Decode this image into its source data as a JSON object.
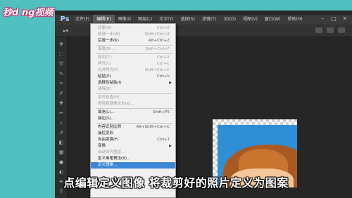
{
  "watermark": {
    "logo_text": "秒d ng视频"
  },
  "app": {
    "logo": "Ps"
  },
  "menubar": {
    "items": [
      {
        "label": "文件(F)"
      },
      {
        "label": "编辑(E)",
        "active": true
      },
      {
        "label": "图像(I)"
      },
      {
        "label": "图层(L)"
      },
      {
        "label": "文字(Y)"
      },
      {
        "label": "选择(S)"
      },
      {
        "label": "滤镜(T)"
      },
      {
        "label": "3D(D)"
      },
      {
        "label": "视图(V)"
      },
      {
        "label": "窗口(W)"
      },
      {
        "label": "帮助(H)"
      }
    ],
    "controls": {
      "minimize": "–",
      "maximize": "□",
      "close": "✕"
    }
  },
  "edit_menu": {
    "items": [
      {
        "label": "还原(O)",
        "shortcut": "Ctrl+Z",
        "state": "disabled"
      },
      {
        "label": "前进一步(W)",
        "shortcut": "Shift+Ctrl+Z",
        "state": "disabled"
      },
      {
        "label": "后退一步(K)",
        "shortcut": "Alt+Ctrl+Z",
        "state": "enabled"
      },
      {
        "separator": true
      },
      {
        "label": "渐隐(D)...",
        "shortcut": "Shift+Ctrl+F",
        "state": "disabled"
      },
      {
        "separator": true
      },
      {
        "label": "剪切(T)",
        "shortcut": "Ctrl+X",
        "state": "disabled"
      },
      {
        "label": "拷贝(C)",
        "shortcut": "Ctrl+C",
        "state": "disabled"
      },
      {
        "label": "合并拷贝(Y)",
        "shortcut": "Shift+Ctrl+C",
        "state": "disabled"
      },
      {
        "label": "粘贴(P)",
        "shortcut": "Ctrl+V",
        "state": "enabled"
      },
      {
        "label": "选择性粘贴(I)",
        "shortcut": "",
        "state": "enabled",
        "submenu": true
      },
      {
        "label": "清除(E)",
        "shortcut": "",
        "state": "disabled"
      },
      {
        "separator": true
      },
      {
        "label": "拼写检查(H)...",
        "shortcut": "",
        "state": "disabled"
      },
      {
        "label": "查找和替换文本(X)...",
        "shortcut": "",
        "state": "disabled"
      },
      {
        "separator": true
      },
      {
        "label": "填充(L)...",
        "shortcut": "Shift+F5",
        "state": "enabled"
      },
      {
        "label": "描边(S)...",
        "shortcut": "",
        "state": "enabled"
      },
      {
        "separator": true
      },
      {
        "label": "内容识别比例",
        "shortcut": "Alt+Shift+Ctrl+C",
        "state": "enabled"
      },
      {
        "label": "操控变形",
        "shortcut": "",
        "state": "enabled"
      },
      {
        "label": "自由变换(F)",
        "shortcut": "Ctrl+T",
        "state": "enabled"
      },
      {
        "label": "变换",
        "shortcut": "",
        "state": "enabled",
        "submenu": true
      },
      {
        "label": "自动对齐图层...",
        "shortcut": "",
        "state": "disabled"
      },
      {
        "label": "定义画笔预设(B)...",
        "shortcut": "",
        "state": "enabled"
      },
      {
        "label": "定义图案...",
        "shortcut": "",
        "state": "highlight"
      }
    ]
  },
  "subtitle": "点编辑定义图像 将裁剪好的照片定义为图案"
}
